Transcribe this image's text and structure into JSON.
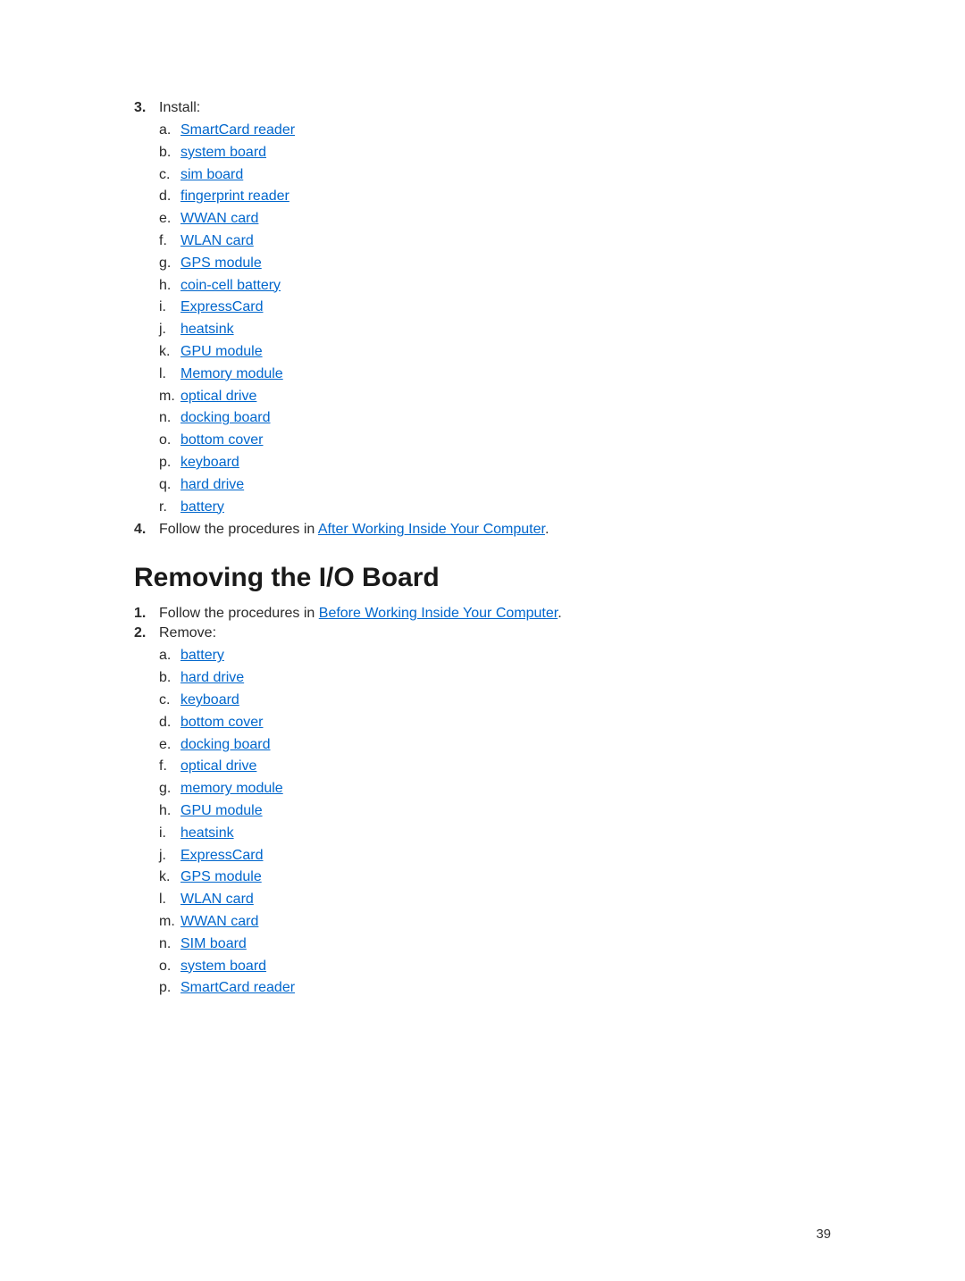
{
  "install": {
    "marker": "3.",
    "intro": "Install:",
    "items": [
      {
        "m": "a.",
        "t": "SmartCard reader"
      },
      {
        "m": "b.",
        "t": "system board"
      },
      {
        "m": "c.",
        "t": "sim board"
      },
      {
        "m": "d.",
        "t": "fingerprint reader"
      },
      {
        "m": "e.",
        "t": "WWAN card"
      },
      {
        "m": "f.",
        "t": "WLAN card"
      },
      {
        "m": "g.",
        "t": "GPS module"
      },
      {
        "m": "h.",
        "t": "coin-cell battery"
      },
      {
        "m": "i.",
        "t": "ExpressCard"
      },
      {
        "m": "j.",
        "t": "heatsink"
      },
      {
        "m": "k.",
        "t": "GPU module"
      },
      {
        "m": "l.",
        "t": "Memory module"
      },
      {
        "m": "m.",
        "t": "optical drive"
      },
      {
        "m": "n.",
        "t": "docking board"
      },
      {
        "m": "o.",
        "t": "bottom cover"
      },
      {
        "m": "p.",
        "t": "keyboard"
      },
      {
        "m": "q.",
        "t": "hard drive"
      },
      {
        "m": "r.",
        "t": "battery"
      }
    ]
  },
  "step4": {
    "marker": "4.",
    "pre": "Follow the procedures in ",
    "link": "After Working Inside Your Computer",
    "post": "."
  },
  "heading": "Removing the I/O Board",
  "step1": {
    "marker": "1.",
    "pre": "Follow the procedures in ",
    "link": "Before Working Inside Your Computer",
    "post": "."
  },
  "remove": {
    "marker": "2.",
    "intro": "Remove:",
    "items": [
      {
        "m": "a.",
        "t": "battery"
      },
      {
        "m": "b.",
        "t": "hard drive"
      },
      {
        "m": "c.",
        "t": "keyboard"
      },
      {
        "m": "d.",
        "t": "bottom cover"
      },
      {
        "m": "e.",
        "t": "docking board"
      },
      {
        "m": "f.",
        "t": "optical drive"
      },
      {
        "m": "g.",
        "t": "memory module"
      },
      {
        "m": "h.",
        "t": "GPU module"
      },
      {
        "m": "i.",
        "t": "heatsink"
      },
      {
        "m": "j.",
        "t": "ExpressCard"
      },
      {
        "m": "k.",
        "t": "GPS module"
      },
      {
        "m": "l.",
        "t": "WLAN card"
      },
      {
        "m": "m.",
        "t": "WWAN card"
      },
      {
        "m": "n.",
        "t": "SIM board"
      },
      {
        "m": "o.",
        "t": "system board"
      },
      {
        "m": "p.",
        "t": "SmartCard reader"
      }
    ]
  },
  "page_number": "39"
}
